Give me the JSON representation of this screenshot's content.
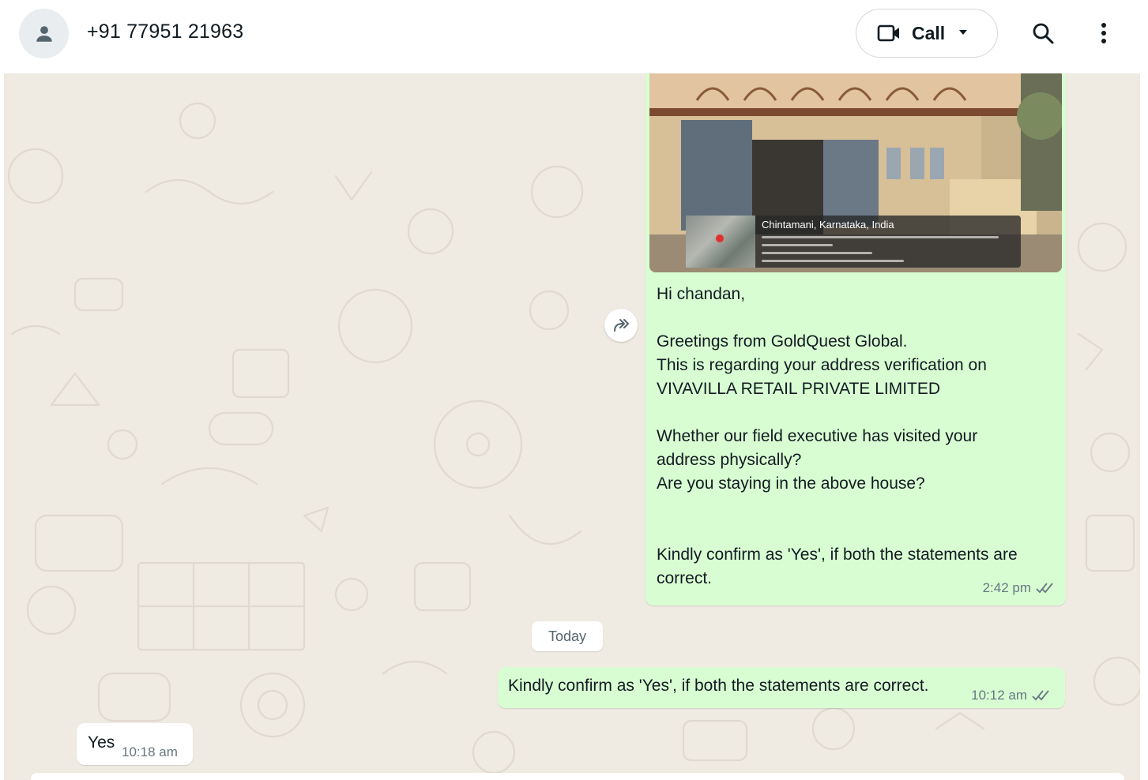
{
  "header": {
    "contact_name": "+91 77951 21963",
    "avatar_icon": "person-icon",
    "call_label": "Call",
    "call_icon": "video-camera-icon",
    "call_dropdown_icon": "caret-down-icon",
    "search_icon": "search-icon",
    "menu_icon": "more-vertical-icon"
  },
  "messages": [
    {
      "direction": "outgoing",
      "has_image": true,
      "image_overlay": {
        "place": "Chintamani, Karnataka, India"
      },
      "text": "Hi chandan,\n\nGreetings from GoldQuest Global.\nThis is regarding your address verification on\nVIVAVILLA RETAIL PRIVATE LIMITED\n\nWhether our field executive has visited your\naddress physically?\nAre you staying in the above house?\n\n\nKindly confirm as 'Yes', if both the statements are\ncorrect.",
      "time": "2:42 pm",
      "status_icon": "double-check-icon"
    },
    {
      "direction": "outgoing",
      "text": "Kindly confirm as 'Yes', if both the statements are correct.",
      "time": "10:12 am",
      "status_icon": "double-check-icon"
    },
    {
      "direction": "incoming",
      "text": "Yes",
      "time": "10:18 am"
    }
  ],
  "date_separator": "Today",
  "forward_icon": "forward-icon",
  "colors": {
    "chat_background": "#efeae2",
    "outgoing_bubble": "#d9fdd3",
    "incoming_bubble": "#ffffff",
    "meta_text": "#667781"
  }
}
